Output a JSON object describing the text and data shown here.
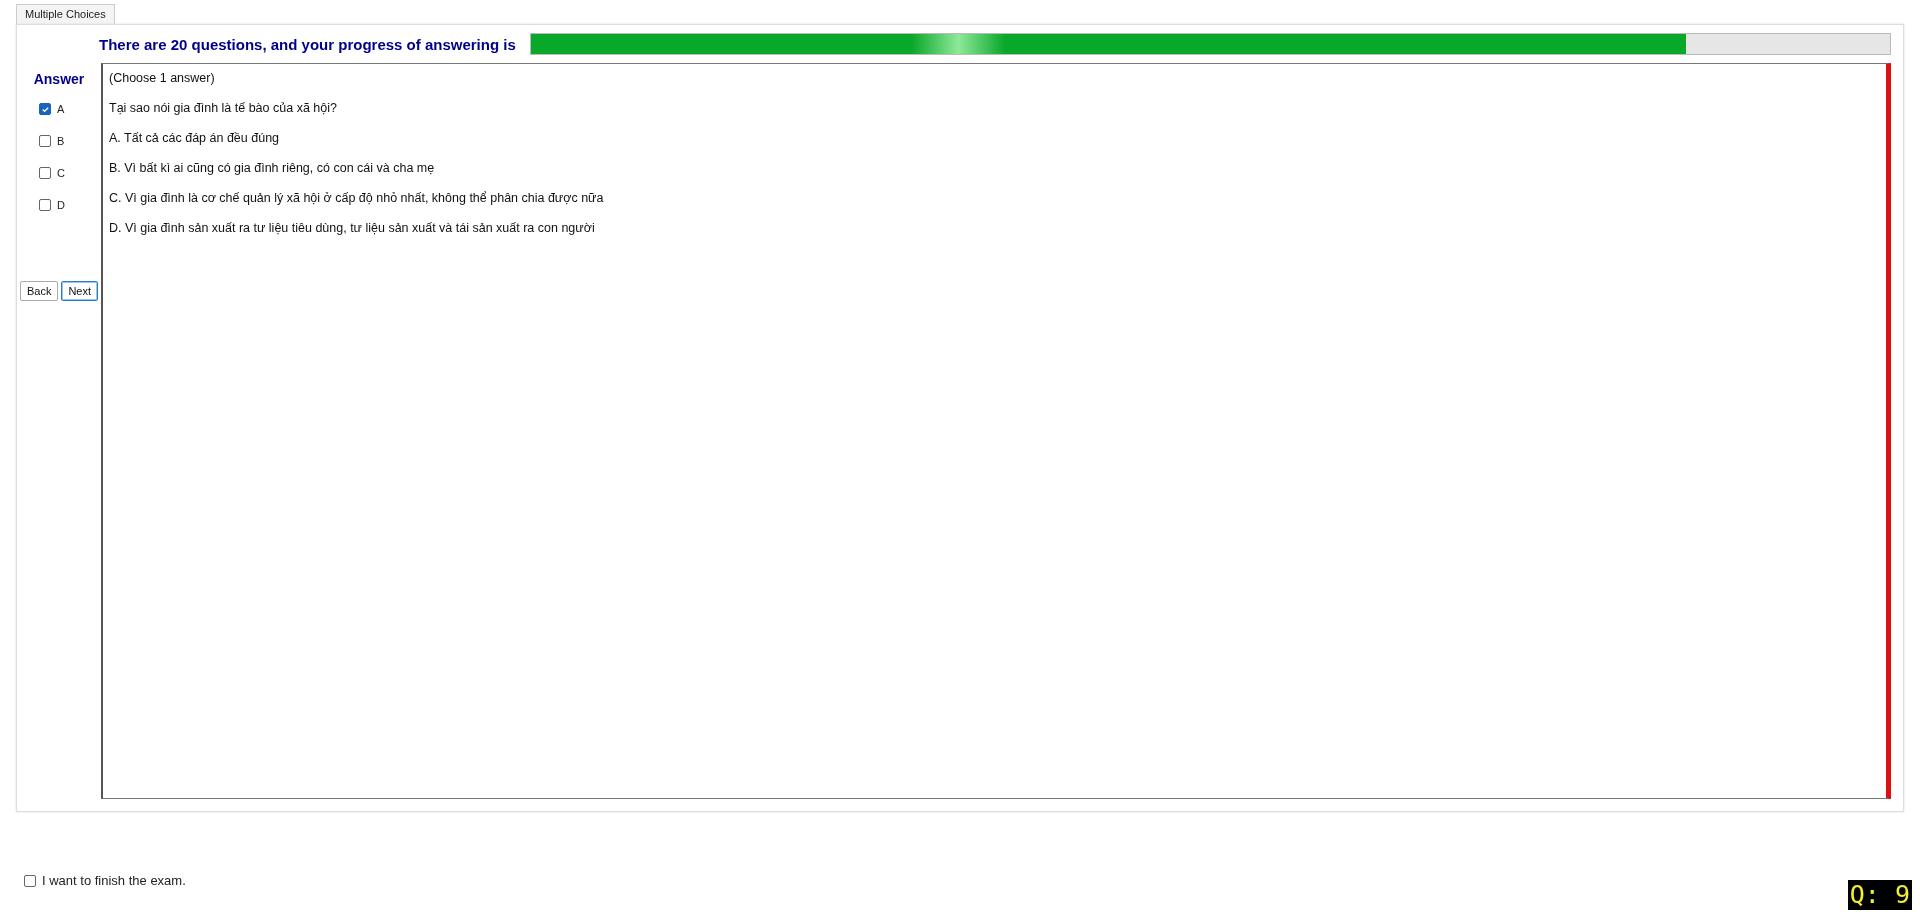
{
  "tab": "Multiple Choices",
  "heading": "There are 20 questions, and your progress of answering is",
  "progress": {
    "level": 0.85
  },
  "answer_panel": {
    "title": "Answer",
    "options": [
      {
        "label": "A",
        "checked": true
      },
      {
        "label": "B",
        "checked": false
      },
      {
        "label": "C",
        "checked": false
      },
      {
        "label": "D",
        "checked": false
      }
    ]
  },
  "buttons": [
    "Back",
    "Next"
  ],
  "question": {
    "instruction": "(Choose 1 answer)",
    "text": "Tại sao nói gia đình là tế bào của xã hội?",
    "choices": [
      "A.  Tất cả các đáp án đều đúng",
      "B.  Vì bất kì ai cũng có gia đình riêng, có con cái và cha mẹ",
      "C.  Vì gia đình là cơ chế quản lý xã hội ở cấp độ nhỏ nhất, không thể phân chia được nữa",
      "D.  Vì gia đình sản xuất ra tư liệu tiêu dùng, tư liệu sản xuất và tái sản xuất ra con người"
    ]
  },
  "finish": {
    "label": "I want to finish the exam.",
    "checked": false
  },
  "question_counter": "Q: 9"
}
